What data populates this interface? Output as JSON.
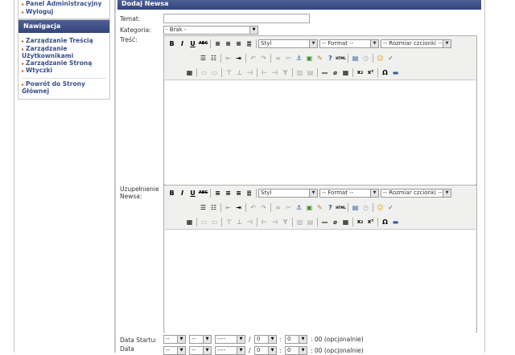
{
  "sidebar": {
    "admin_links": [
      "Panel Administracyjny",
      "Wyloguj"
    ],
    "nav_title": "Nawigacja",
    "nav_links": [
      "Zarządzanie Treścią",
      "Zarządzanie Użytkownikami",
      "Zarządzanie Stroną",
      "Wtyczki"
    ],
    "back_link": "Powrót do Strony Głównej"
  },
  "main": {
    "title": "Dodaj Newsa",
    "temat_label": "Temat:",
    "temat_value": "",
    "kategoria_label": "Kategoria:",
    "kategoria_value": "- Brak -",
    "tresc_label": "Treść:",
    "uzup_label": "Uzupełnienie Newsa:",
    "editor": {
      "styl": "Styl",
      "format": "-- Format --",
      "rozmiar": "-- Rozmiar czcionki --"
    },
    "start_label": "Data Startu:",
    "end_label": "Data",
    "date": {
      "day": "--",
      "month": "--",
      "year": "----",
      "hour": "0",
      "minute": "0",
      "note": ": 00 (opcjonalnie)"
    }
  }
}
